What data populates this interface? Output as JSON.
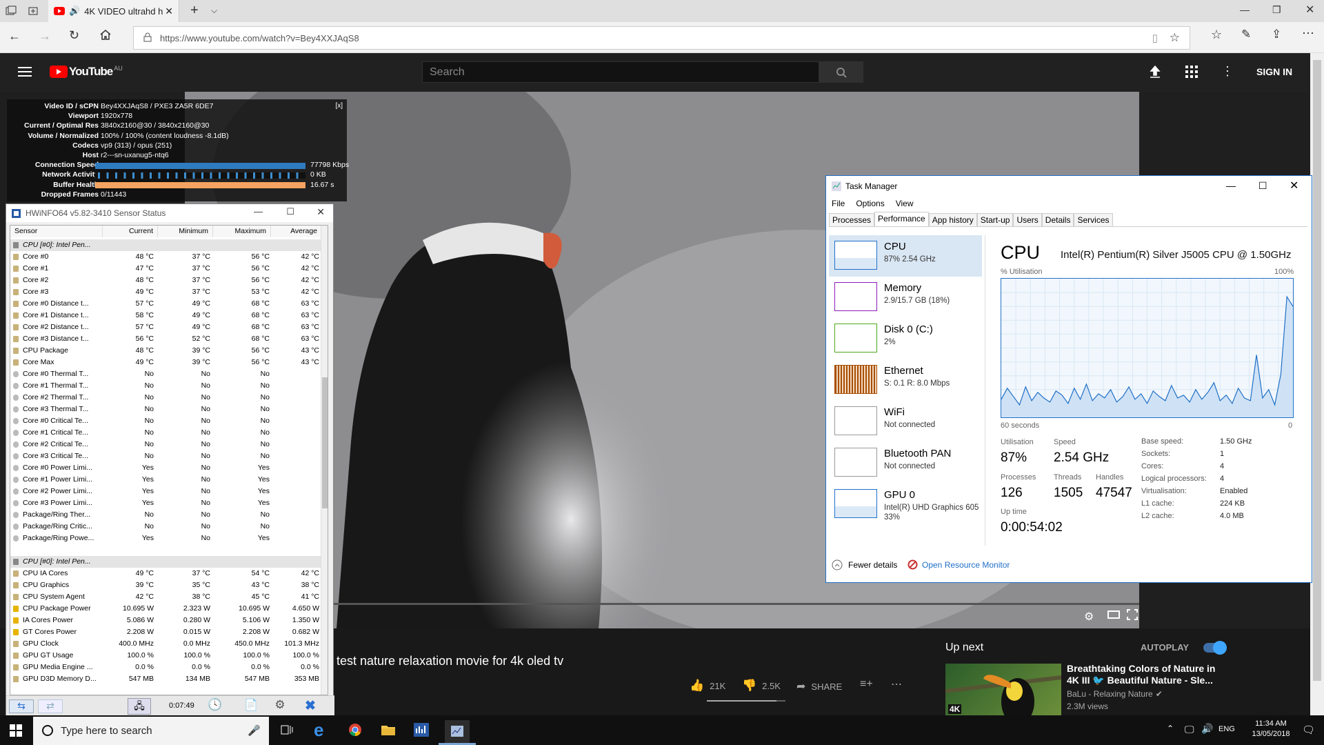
{
  "browser": {
    "tab_title": "4K VIDEO ultrahd h",
    "url": "https://www.youtube.com/watch?v=Bey4XXJAqS8"
  },
  "youtube": {
    "logo": "YouTube",
    "region": "AU",
    "search_placeholder": "Search",
    "sign_in": "SIGN IN",
    "video_title": "test nature relaxation movie for 4k oled tv",
    "likes": "21K",
    "dislikes": "2.5K",
    "share": "SHARE",
    "up_next": "Up next",
    "autoplay": "AUTOPLAY",
    "next_video": {
      "title_line1": "Breathtaking Colors of Nature in",
      "title_line2": "4K III 🐦 Beautiful Nature - Sle...",
      "channel": "BaLu - Relaxing Nature",
      "views": "2.3M views",
      "badge": "4K"
    }
  },
  "stats": {
    "close": "[x]",
    "rows": [
      {
        "k": "Video ID / sCPN",
        "v": "Bey4XXJAqS8 / PXE3 ZA5R 6DE7"
      },
      {
        "k": "Viewport",
        "v": "1920x778"
      },
      {
        "k": "Current / Optimal Res",
        "v": "3840x2160@30 / 3840x2160@30"
      },
      {
        "k": "Volume / Normalized",
        "v": "100% / 100% (content loudness -8.1dB)"
      },
      {
        "k": "Codecs",
        "v": "vp9 (313) / opus (251)"
      },
      {
        "k": "Host",
        "v": "r2---sn-uxanug5-ntq6"
      },
      {
        "k": "Connection Speed",
        "v": "77798 Kbps"
      },
      {
        "k": "Network Activity",
        "v": "0 KB"
      },
      {
        "k": "Buffer Health",
        "v": "16.67 s"
      },
      {
        "k": "Dropped Frames",
        "v": "0/11443"
      }
    ]
  },
  "hwinfo": {
    "title": "HWiNFO64 v5.82-3410 Sensor Status",
    "headers": [
      "Sensor",
      "Current",
      "Minimum",
      "Maximum",
      "Average"
    ],
    "timer": "0:07:49",
    "rows": [
      [
        "CPU [#0]: Intel Pen...",
        "",
        "",
        "",
        ""
      ],
      [
        "Core #0",
        "48 °C",
        "37 °C",
        "56 °C",
        "42 °C"
      ],
      [
        "Core #1",
        "47 °C",
        "37 °C",
        "56 °C",
        "42 °C"
      ],
      [
        "Core #2",
        "48 °C",
        "37 °C",
        "56 °C",
        "42 °C"
      ],
      [
        "Core #3",
        "49 °C",
        "37 °C",
        "53 °C",
        "42 °C"
      ],
      [
        "Core #0 Distance t...",
        "57 °C",
        "49 °C",
        "68 °C",
        "63 °C"
      ],
      [
        "Core #1 Distance t...",
        "58 °C",
        "49 °C",
        "68 °C",
        "63 °C"
      ],
      [
        "Core #2 Distance t...",
        "57 °C",
        "49 °C",
        "68 °C",
        "63 °C"
      ],
      [
        "Core #3 Distance t...",
        "56 °C",
        "52 °C",
        "68 °C",
        "63 °C"
      ],
      [
        "CPU Package",
        "48 °C",
        "39 °C",
        "56 °C",
        "43 °C"
      ],
      [
        "Core Max",
        "49 °C",
        "39 °C",
        "56 °C",
        "43 °C"
      ],
      [
        "Core #0 Thermal T...",
        "No",
        "No",
        "No",
        ""
      ],
      [
        "Core #1 Thermal T...",
        "No",
        "No",
        "No",
        ""
      ],
      [
        "Core #2 Thermal T...",
        "No",
        "No",
        "No",
        ""
      ],
      [
        "Core #3 Thermal T...",
        "No",
        "No",
        "No",
        ""
      ],
      [
        "Core #0 Critical Te...",
        "No",
        "No",
        "No",
        ""
      ],
      [
        "Core #1 Critical Te...",
        "No",
        "No",
        "No",
        ""
      ],
      [
        "Core #2 Critical Te...",
        "No",
        "No",
        "No",
        ""
      ],
      [
        "Core #3 Critical Te...",
        "No",
        "No",
        "No",
        ""
      ],
      [
        "Core #0 Power Limi...",
        "Yes",
        "No",
        "Yes",
        ""
      ],
      [
        "Core #1 Power Limi...",
        "Yes",
        "No",
        "Yes",
        ""
      ],
      [
        "Core #2 Power Limi...",
        "Yes",
        "No",
        "Yes",
        ""
      ],
      [
        "Core #3 Power Limi...",
        "Yes",
        "No",
        "Yes",
        ""
      ],
      [
        "Package/Ring Ther...",
        "No",
        "No",
        "No",
        ""
      ],
      [
        "Package/Ring Critic...",
        "No",
        "No",
        "No",
        ""
      ],
      [
        "Package/Ring Powe...",
        "Yes",
        "No",
        "Yes",
        ""
      ],
      [
        "",
        "",
        "",
        "",
        ""
      ],
      [
        "CPU [#0]: Intel Pen...",
        "",
        "",
        "",
        ""
      ],
      [
        "CPU IA Cores",
        "49 °C",
        "37 °C",
        "54 °C",
        "42 °C"
      ],
      [
        "CPU Graphics",
        "39 °C",
        "35 °C",
        "43 °C",
        "38 °C"
      ],
      [
        "CPU System Agent",
        "42 °C",
        "38 °C",
        "45 °C",
        "41 °C"
      ],
      [
        "CPU Package Power",
        "10.695 W",
        "2.323 W",
        "10.695 W",
        "4.650 W"
      ],
      [
        "IA Cores Power",
        "5.086 W",
        "0.280 W",
        "5.106 W",
        "1.350 W"
      ],
      [
        "GT Cores Power",
        "2.208 W",
        "0.015 W",
        "2.208 W",
        "0.682 W"
      ],
      [
        "GPU Clock",
        "400.0 MHz",
        "0.0 MHz",
        "450.0 MHz",
        "101.3 MHz"
      ],
      [
        "GPU GT Usage",
        "100.0 %",
        "100.0 %",
        "100.0 %",
        "100.0 %"
      ],
      [
        "GPU Media Engine ...",
        "0.0 %",
        "0.0 %",
        "0.0 %",
        "0.0 %"
      ],
      [
        "GPU D3D Memory D...",
        "547 MB",
        "134 MB",
        "547 MB",
        "353 MB"
      ]
    ]
  },
  "taskmanager": {
    "title": "Task Manager",
    "menu": [
      "File",
      "Options",
      "View"
    ],
    "tabs": [
      "Processes",
      "Performance",
      "App history",
      "Start-up",
      "Users",
      "Details",
      "Services"
    ],
    "resources": [
      {
        "name": "CPU",
        "sub": "87% 2.54 GHz"
      },
      {
        "name": "Memory",
        "sub": "2.9/15.7 GB (18%)"
      },
      {
        "name": "Disk 0 (C:)",
        "sub": "2%"
      },
      {
        "name": "Ethernet",
        "sub": "S: 0.1 R: 8.0 Mbps"
      },
      {
        "name": "WiFi",
        "sub": "Not connected"
      },
      {
        "name": "Bluetooth PAN",
        "sub": "Not connected"
      },
      {
        "name": "GPU 0",
        "sub": "Intel(R) UHD Graphics 605",
        "sub2": "33%"
      }
    ],
    "cpu_heading": "CPU",
    "cpu_model": "Intel(R) Pentium(R) Silver J5005 CPU @ 1.50GHz",
    "graph_label": "% Utilisation",
    "graph_max": "100%",
    "graph_time": "60 seconds",
    "graph_min": "0",
    "utilisation_label": "Utilisation",
    "utilisation": "87%",
    "speed_label": "Speed",
    "speed": "2.54 GHz",
    "processes_label": "Processes",
    "processes": "126",
    "threads_label": "Threads",
    "threads": "1505",
    "handles_label": "Handles",
    "handles": "47547",
    "uptime_label": "Up time",
    "uptime": "0:00:54:02",
    "specs": [
      {
        "k": "Base speed:",
        "v": "1.50 GHz"
      },
      {
        "k": "Sockets:",
        "v": "1"
      },
      {
        "k": "Cores:",
        "v": "4"
      },
      {
        "k": "Logical processors:",
        "v": "4"
      },
      {
        "k": "Virtualisation:",
        "v": "Enabled"
      },
      {
        "k": "L1 cache:",
        "v": "224 KB"
      },
      {
        "k": "L2 cache:",
        "v": "4.0 MB"
      }
    ],
    "fewer_details": "Fewer details",
    "resource_monitor": "Open Resource Monitor",
    "cpu_history": [
      13,
      21,
      15,
      9,
      22,
      12,
      18,
      14,
      11,
      19,
      16,
      10,
      21,
      13,
      24,
      12,
      17,
      14,
      20,
      11,
      15,
      22,
      13,
      17,
      10,
      19,
      15,
      12,
      23,
      14,
      16,
      11,
      20,
      13,
      18,
      25,
      12,
      16,
      10,
      21,
      14,
      12,
      45,
      14,
      20,
      9,
      31,
      87,
      80
    ]
  },
  "taskbar": {
    "search_placeholder": "Type here to search",
    "lang": "ENG",
    "time": "11:34 AM",
    "date": "13/05/2018"
  },
  "colors": {
    "youtube_red": "#ff0000",
    "tm_blue": "#1f6fc8",
    "hw_bar": "#3d8fd1",
    "buffer_bar": "#f4a460"
  }
}
